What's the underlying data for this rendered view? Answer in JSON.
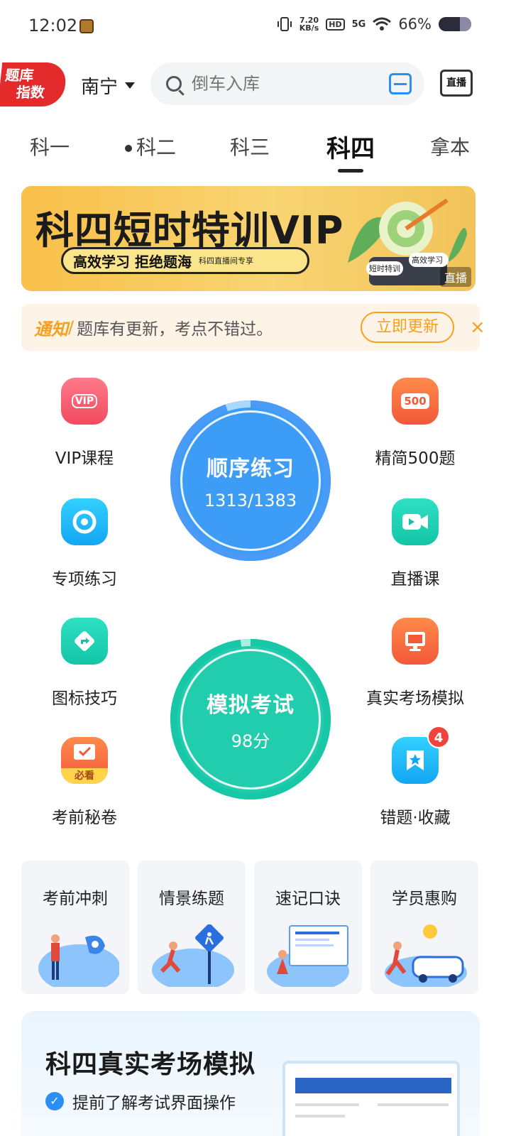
{
  "status_bar": {
    "time": "12:02",
    "net_speed_top": "7.20",
    "net_speed_bottom": "KB/s",
    "hd": "HD",
    "signal": "5G",
    "battery": "66%"
  },
  "header": {
    "logo_line1": "题库",
    "logo_line2": "指数",
    "city": "南宁",
    "search_placeholder": "倒车入库",
    "live_label": "直播"
  },
  "tabs": [
    {
      "label": "科一"
    },
    {
      "label": "科二"
    },
    {
      "label": "科三"
    },
    {
      "label": "科四"
    },
    {
      "label": "拿本"
    }
  ],
  "banner": {
    "title": "科四短时特训VIP",
    "pill_text": "高效学习 拒绝题海",
    "pill_small": "科四直播间专享",
    "tag1": "短时特训",
    "tag2": "高效学习",
    "live": "直播"
  },
  "notice": {
    "tag": "通知",
    "slash": "/",
    "message": "题库有更新，考点不错过。",
    "action": "立即更新",
    "close": "×"
  },
  "features": {
    "vip": {
      "label": "VIP课程",
      "icon_text": "VIP"
    },
    "jingjian": {
      "label": "精简500题",
      "icon_text": "500"
    },
    "zhuanxiang": {
      "label": "专项练习"
    },
    "zhibo": {
      "label": "直播课"
    },
    "tubiao": {
      "label": "图标技巧"
    },
    "zhenshi": {
      "label": "真实考场模拟"
    },
    "miju": {
      "label": "考前秘卷",
      "icon_text": "必看"
    },
    "cuoti": {
      "label": "错题·收藏",
      "badge": "4"
    }
  },
  "practice": {
    "title": "顺序练习",
    "progress": "1313/1383",
    "done": 1313,
    "total": 1383
  },
  "exam": {
    "title": "模拟考试",
    "score": "98分",
    "score_value": 98
  },
  "cards": [
    {
      "label": "考前冲刺"
    },
    {
      "label": "情景练题"
    },
    {
      "label": "速记口诀"
    },
    {
      "label": "学员惠购"
    }
  ],
  "promo": {
    "title": "科四真实考场模拟",
    "point1": "提前了解考试界面操作",
    "check": "✓"
  },
  "colors": {
    "accent_blue": "#2a8ef5",
    "accent_teal": "#1cc9a8",
    "notice_orange": "#f5a11c",
    "badge_red": "#f0433b"
  }
}
